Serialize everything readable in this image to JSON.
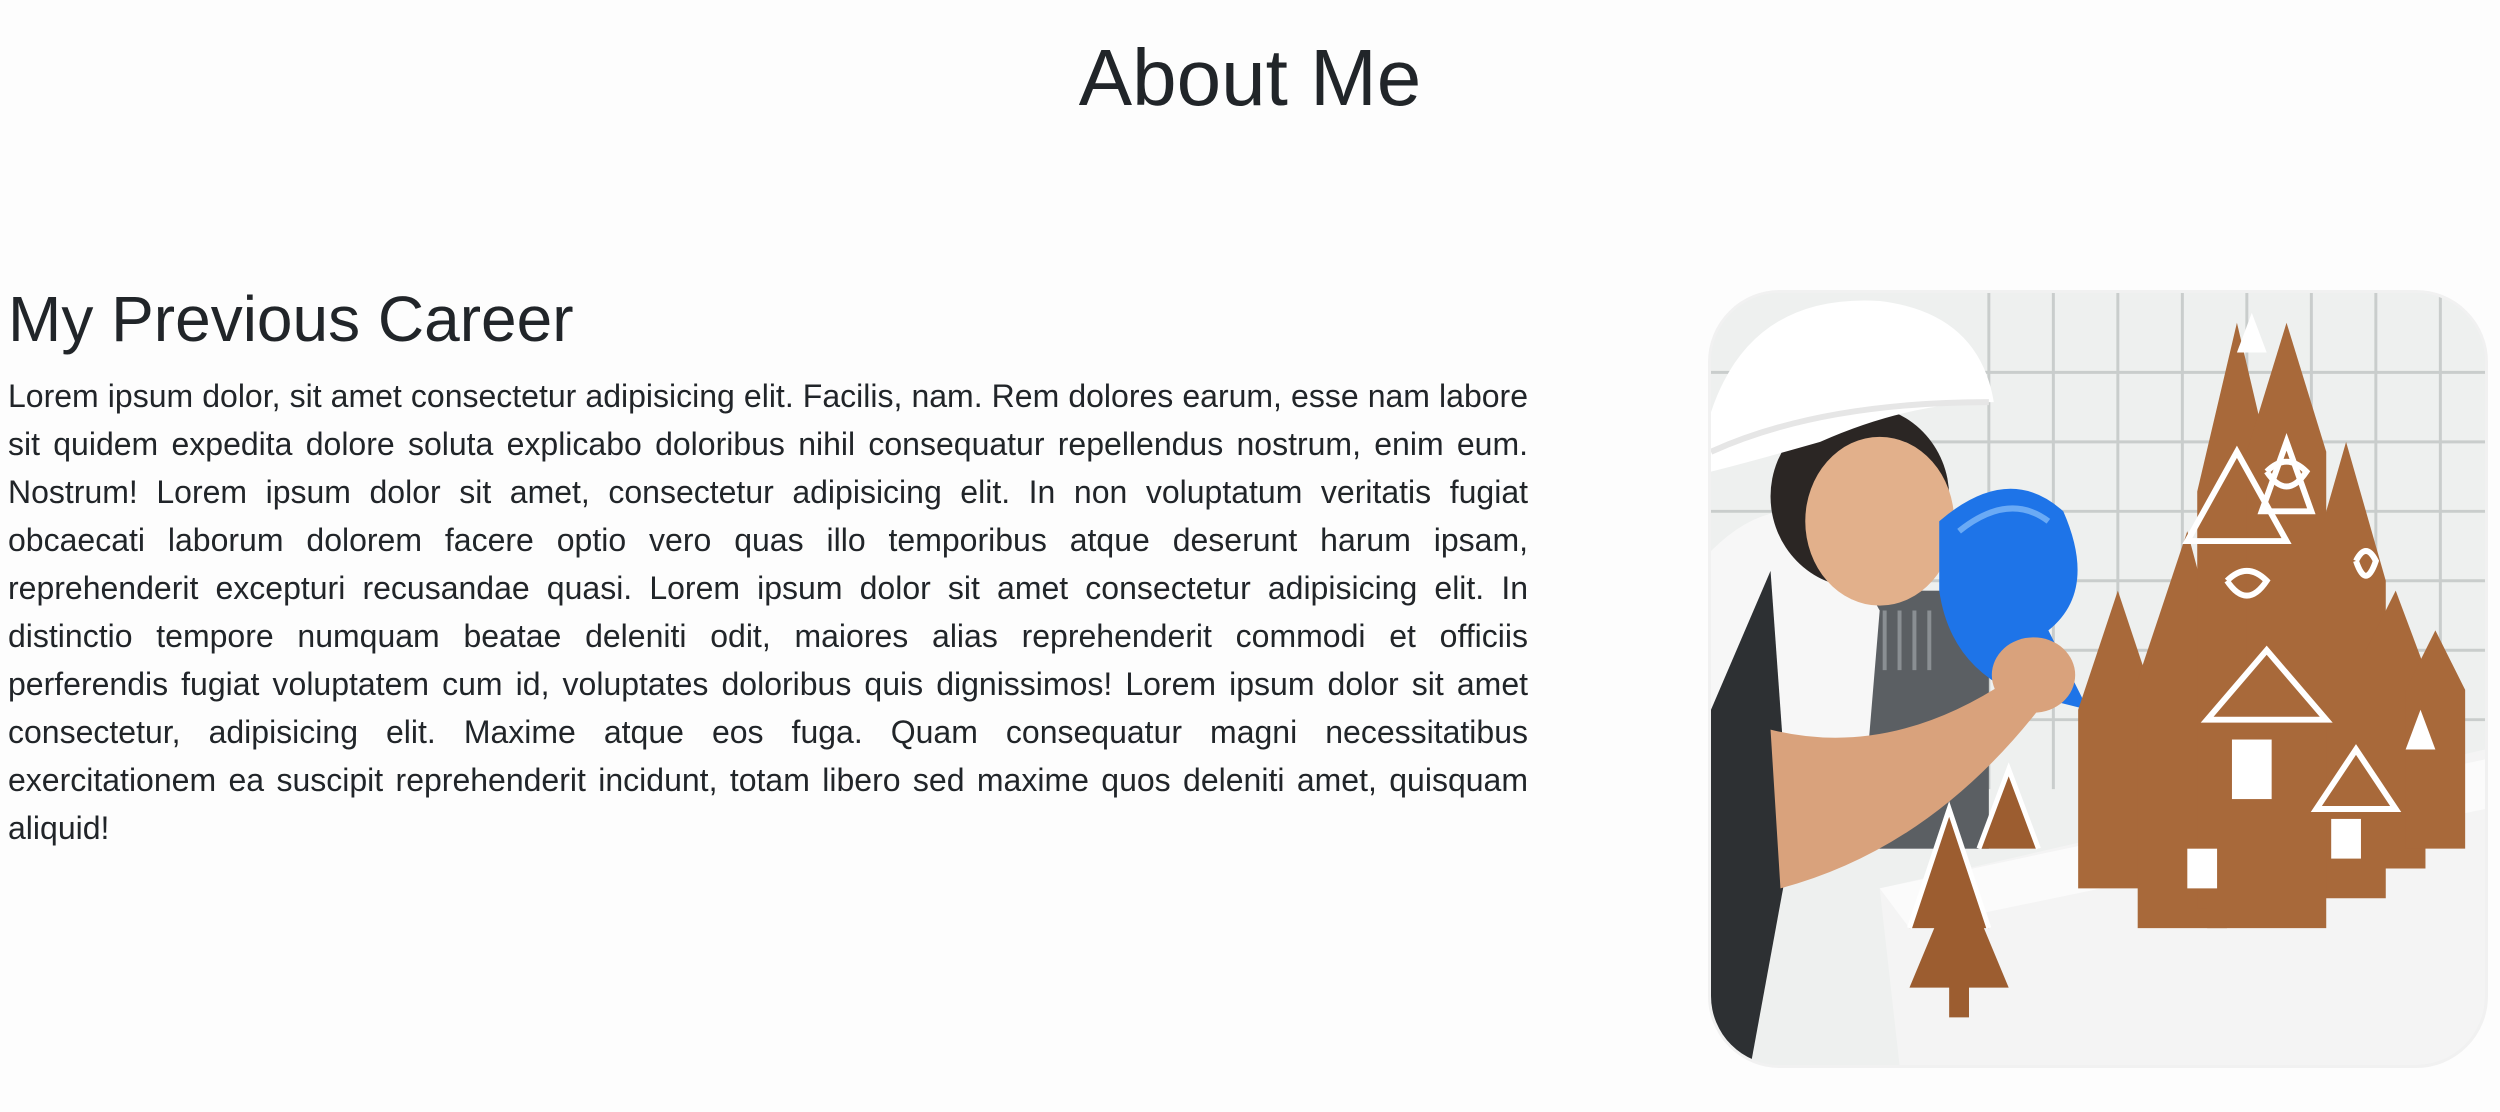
{
  "page": {
    "title": "About Me"
  },
  "section": {
    "heading": "My Previous Career",
    "paragraph": "Lorem ipsum dolor, sit amet consectetur adipisicing elit. Facilis, nam. Rem dolores earum, esse nam labore sit quidem expedita dolore soluta explicabo doloribus nihil consequatur repellendus nostrum, enim eum. Nostrum! Lorem ipsum dolor sit amet, consectetur adipisicing elit. In non voluptatum veritatis fugiat obcaecati laborum dolorem facere optio vero quas illo temporibus atque deserunt harum ipsam, reprehenderit excepturi recusandae quasi. Lorem ipsum dolor sit amet consectetur adipisicing elit. In distinctio tempore numquam beatae deleniti odit, maiores alias reprehenderit commodi et officiis perferendis fugiat voluptatem cum id, voluptates doloribus quis dignissimos! Lorem ipsum dolor sit amet consectetur, adipisicing elit. Maxime atque eos fuga. Quam consequatur magni necessitatibus exercitationem ea suscipit reprehenderit incidunt, totam libero sed maxime quos deleniti amet, quisquam aliquid!"
  },
  "colors": {
    "background": "#fdfdfd",
    "text": "#212529",
    "gingerbread": "#a8693a",
    "icing": "#ffffff",
    "piping_bag": "#1e74e8",
    "tile": "#eef0ef"
  }
}
